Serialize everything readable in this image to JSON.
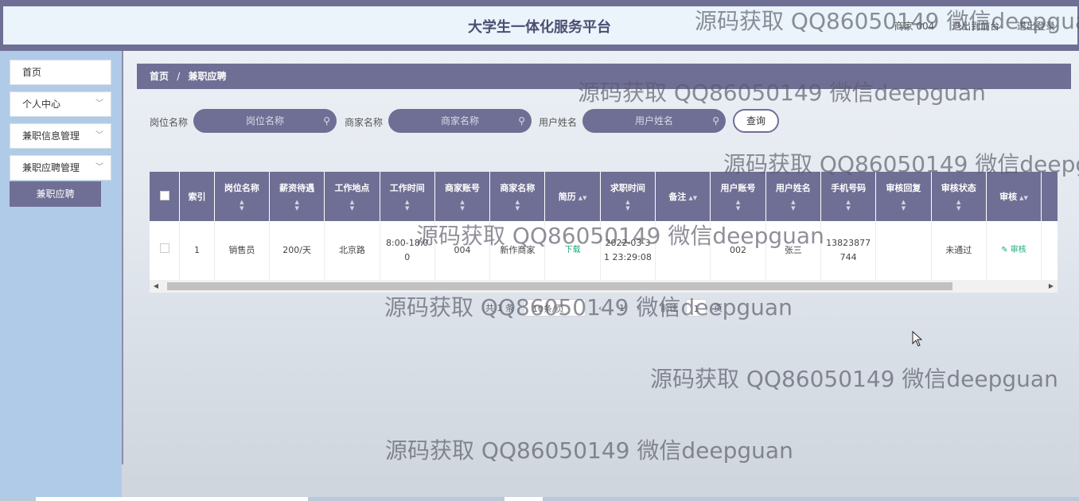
{
  "header": {
    "title": "大学生一体化服务平台",
    "user_label": "商家 004",
    "back_to_front": "退出到前台",
    "logout": "退出登录"
  },
  "sidebar": {
    "items": [
      {
        "label": "首页"
      },
      {
        "label": "个人中心"
      },
      {
        "label": "兼职信息管理"
      },
      {
        "label": "兼职应聘管理"
      }
    ],
    "sub_item": "兼职应聘"
  },
  "breadcrumb": {
    "home": "首页",
    "sep": "/",
    "current": "兼职应聘"
  },
  "search": {
    "job_label": "岗位名称",
    "job_placeholder": "岗位名称",
    "merchant_label": "商家名称",
    "merchant_placeholder": "商家名称",
    "user_label": "用户姓名",
    "user_placeholder": "用户姓名",
    "query_button": "查询"
  },
  "table": {
    "columns": [
      "索引",
      "岗位名称",
      "薪资待遇",
      "工作地点",
      "工作时间",
      "商家账号",
      "商家名称",
      "简历",
      "求职时间",
      "备注",
      "用户账号",
      "用户姓名",
      "手机号码",
      "审核回复",
      "审核状态",
      "审核"
    ],
    "rows": [
      {
        "index": "1",
        "job_name": "销售员",
        "salary": "200/天",
        "location": "北京路",
        "work_time": "8:00-18:00",
        "merchant_account": "004",
        "merchant_name": "新作商家",
        "resume": "下载",
        "apply_time": "2022-03-31 23:29:08",
        "remark": "",
        "user_account": "002",
        "user_name": "张三",
        "phone": "13823877744",
        "review_reply": "",
        "review_status": "未通过",
        "review_action": "审核"
      }
    ]
  },
  "pagination": {
    "total": "共 1 条",
    "page_size": "10条/页",
    "current_page": "1",
    "goto_label": "前往",
    "goto_value": "1",
    "page_suffix": "页"
  },
  "watermark": "源码获取 QQ86050149 微信deepguan",
  "colors": {
    "primary": "#6f6f95",
    "sidebar": "#b0cbe8",
    "header_bg": "#eaf4fa",
    "success_green": "#1aa97a"
  }
}
